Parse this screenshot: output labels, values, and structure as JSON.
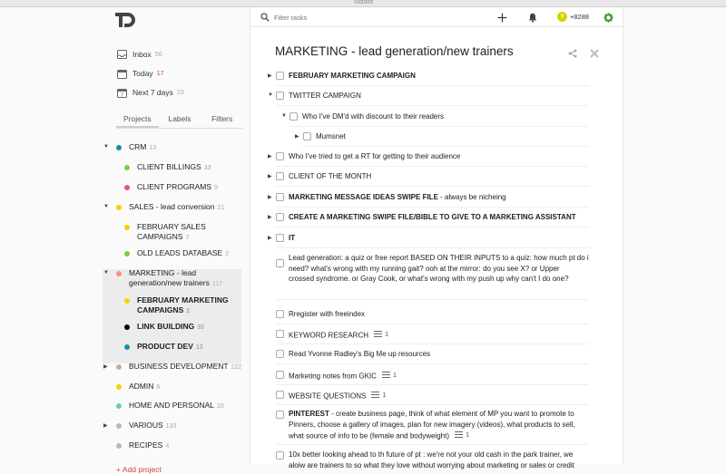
{
  "window": {
    "title": "Todoist"
  },
  "sidebar": {
    "filters": [
      {
        "label": "Inbox",
        "count": "56",
        "icon": "inbox-icon"
      },
      {
        "label": "Today",
        "count": "17",
        "icon": "calendar-today-icon"
      },
      {
        "label": "Next 7 days",
        "count": "23",
        "icon": "calendar-week-icon"
      }
    ],
    "tabs": [
      "Projects",
      "Labels",
      "Filters"
    ],
    "projects": [
      {
        "name": "CRM",
        "count": "13",
        "color": "#158fad",
        "expanded": true
      },
      {
        "name": "CLIENT BILLINGS",
        "count": "33",
        "color": "#7ecc49"
      },
      {
        "name": "CLIENT PROGRAMS",
        "count": "9",
        "color": "#e05194"
      },
      {
        "name": "SALES - lead conversion",
        "count": "21",
        "color": "#fad000",
        "expanded": true
      },
      {
        "name_line1": "FEBRUARY SALES",
        "name_line2": "CAMPAIGNS",
        "count": "7",
        "color": "#fad000"
      },
      {
        "name": "OLD LEADS DATABASE",
        "count": "2",
        "color": "#7ecc49"
      },
      {
        "name_line1": "MARKETING - lead",
        "name_line2": "generation/new trainers",
        "count": "117",
        "color": "#ff8d85",
        "expanded": true
      },
      {
        "name_line1": "FEBRUARY MARKETING",
        "name_line2": "CAMPAIGNS",
        "count": "2",
        "color": "#fad000"
      },
      {
        "name": "LINK BUILDING",
        "count": "35",
        "color": "#000000"
      },
      {
        "name": "PRODUCT DEV",
        "count": "13",
        "color": "#158fad"
      },
      {
        "name": "BUSINESS DEVELOPMENT",
        "count": "222",
        "color": "#ccac93"
      },
      {
        "name": "ADMIN",
        "count": "6",
        "color": "#fad000"
      },
      {
        "name": "HOME AND PERSONAL",
        "count": "33",
        "color": "#6accbc"
      },
      {
        "name": "VARIOUS",
        "count": "133",
        "color": "#b8b8b8"
      },
      {
        "name": "RECIPES",
        "count": "4",
        "color": "#b8b8b8"
      }
    ],
    "add_project": "+ Add project"
  },
  "topbar": {
    "search_placeholder": "Filter tasks",
    "karma": "8288",
    "karma_badge": "Y",
    "karma_prefix": "+"
  },
  "main": {
    "title": "MARKETING - lead generation/new trainers",
    "tasks": [
      {
        "bold": "FEBRUARY MARKETING CAMPAIGN",
        "rest": ""
      },
      {
        "bold": "",
        "rest": "TWITTER CAMPAIGN"
      },
      {
        "bold": "",
        "rest": "Who I've DM'd with discount to their readers"
      },
      {
        "bold": "",
        "rest": "Mumsnet"
      },
      {
        "bold": "",
        "rest": "Who I've tried to get a RT for getting to their audience"
      },
      {
        "bold": "",
        "rest": "CLIENT OF THE MONTH"
      },
      {
        "bold": "MARKETING MESSAGE IDEAS SWIPE FILE",
        "rest": " - always be nicheing"
      },
      {
        "bold": "CREATE A MARKETING SWIPE FILE/BIBLE TO GIVE TO A MARKETING ASSISTANT",
        "rest": ""
      },
      {
        "bold": "IT",
        "rest": ""
      },
      {
        "line1": "Lead generation: a quiz or free report BASED ON THEIR INPUTS to a quiz: how much pt do i",
        "line2": "need? what's wrong with my running gait? ooh at the mirror: do you see X? or Upper",
        "line3": "crossed syndrome. or Gray Cook, or what's wrong with my push up why can't I do one?"
      },
      {
        "bold": "",
        "rest": "Rregister with freeindex"
      },
      {
        "bold": "",
        "rest": "KEYWORD RESEARCH",
        "notes": "1"
      },
      {
        "bold": "",
        "rest": "Read Yvonne Radley's Big Me up resources"
      },
      {
        "bold": "",
        "rest": "Marketing notes from GKIC",
        "notes": "1"
      },
      {
        "bold": "",
        "rest": "WEBSITE QUESTIONS",
        "notes": "1"
      },
      {
        "bold_line1": "PINTEREST",
        "line1": " - create business page, think of what element of MP you want to promote to",
        "line2": "Pinners, choose a gallery of images, plan for new imagery (videos), what products to sell,",
        "line3": "what source of info to be (female and bodyweight)",
        "notes": "1"
      },
      {
        "line1": "10x better looking ahead to th future of pt : we're not your old cash in the park trainer, we",
        "line2": "aloiw are trainers to so what they love without worrying about marketing or sales or credit"
      }
    ]
  }
}
